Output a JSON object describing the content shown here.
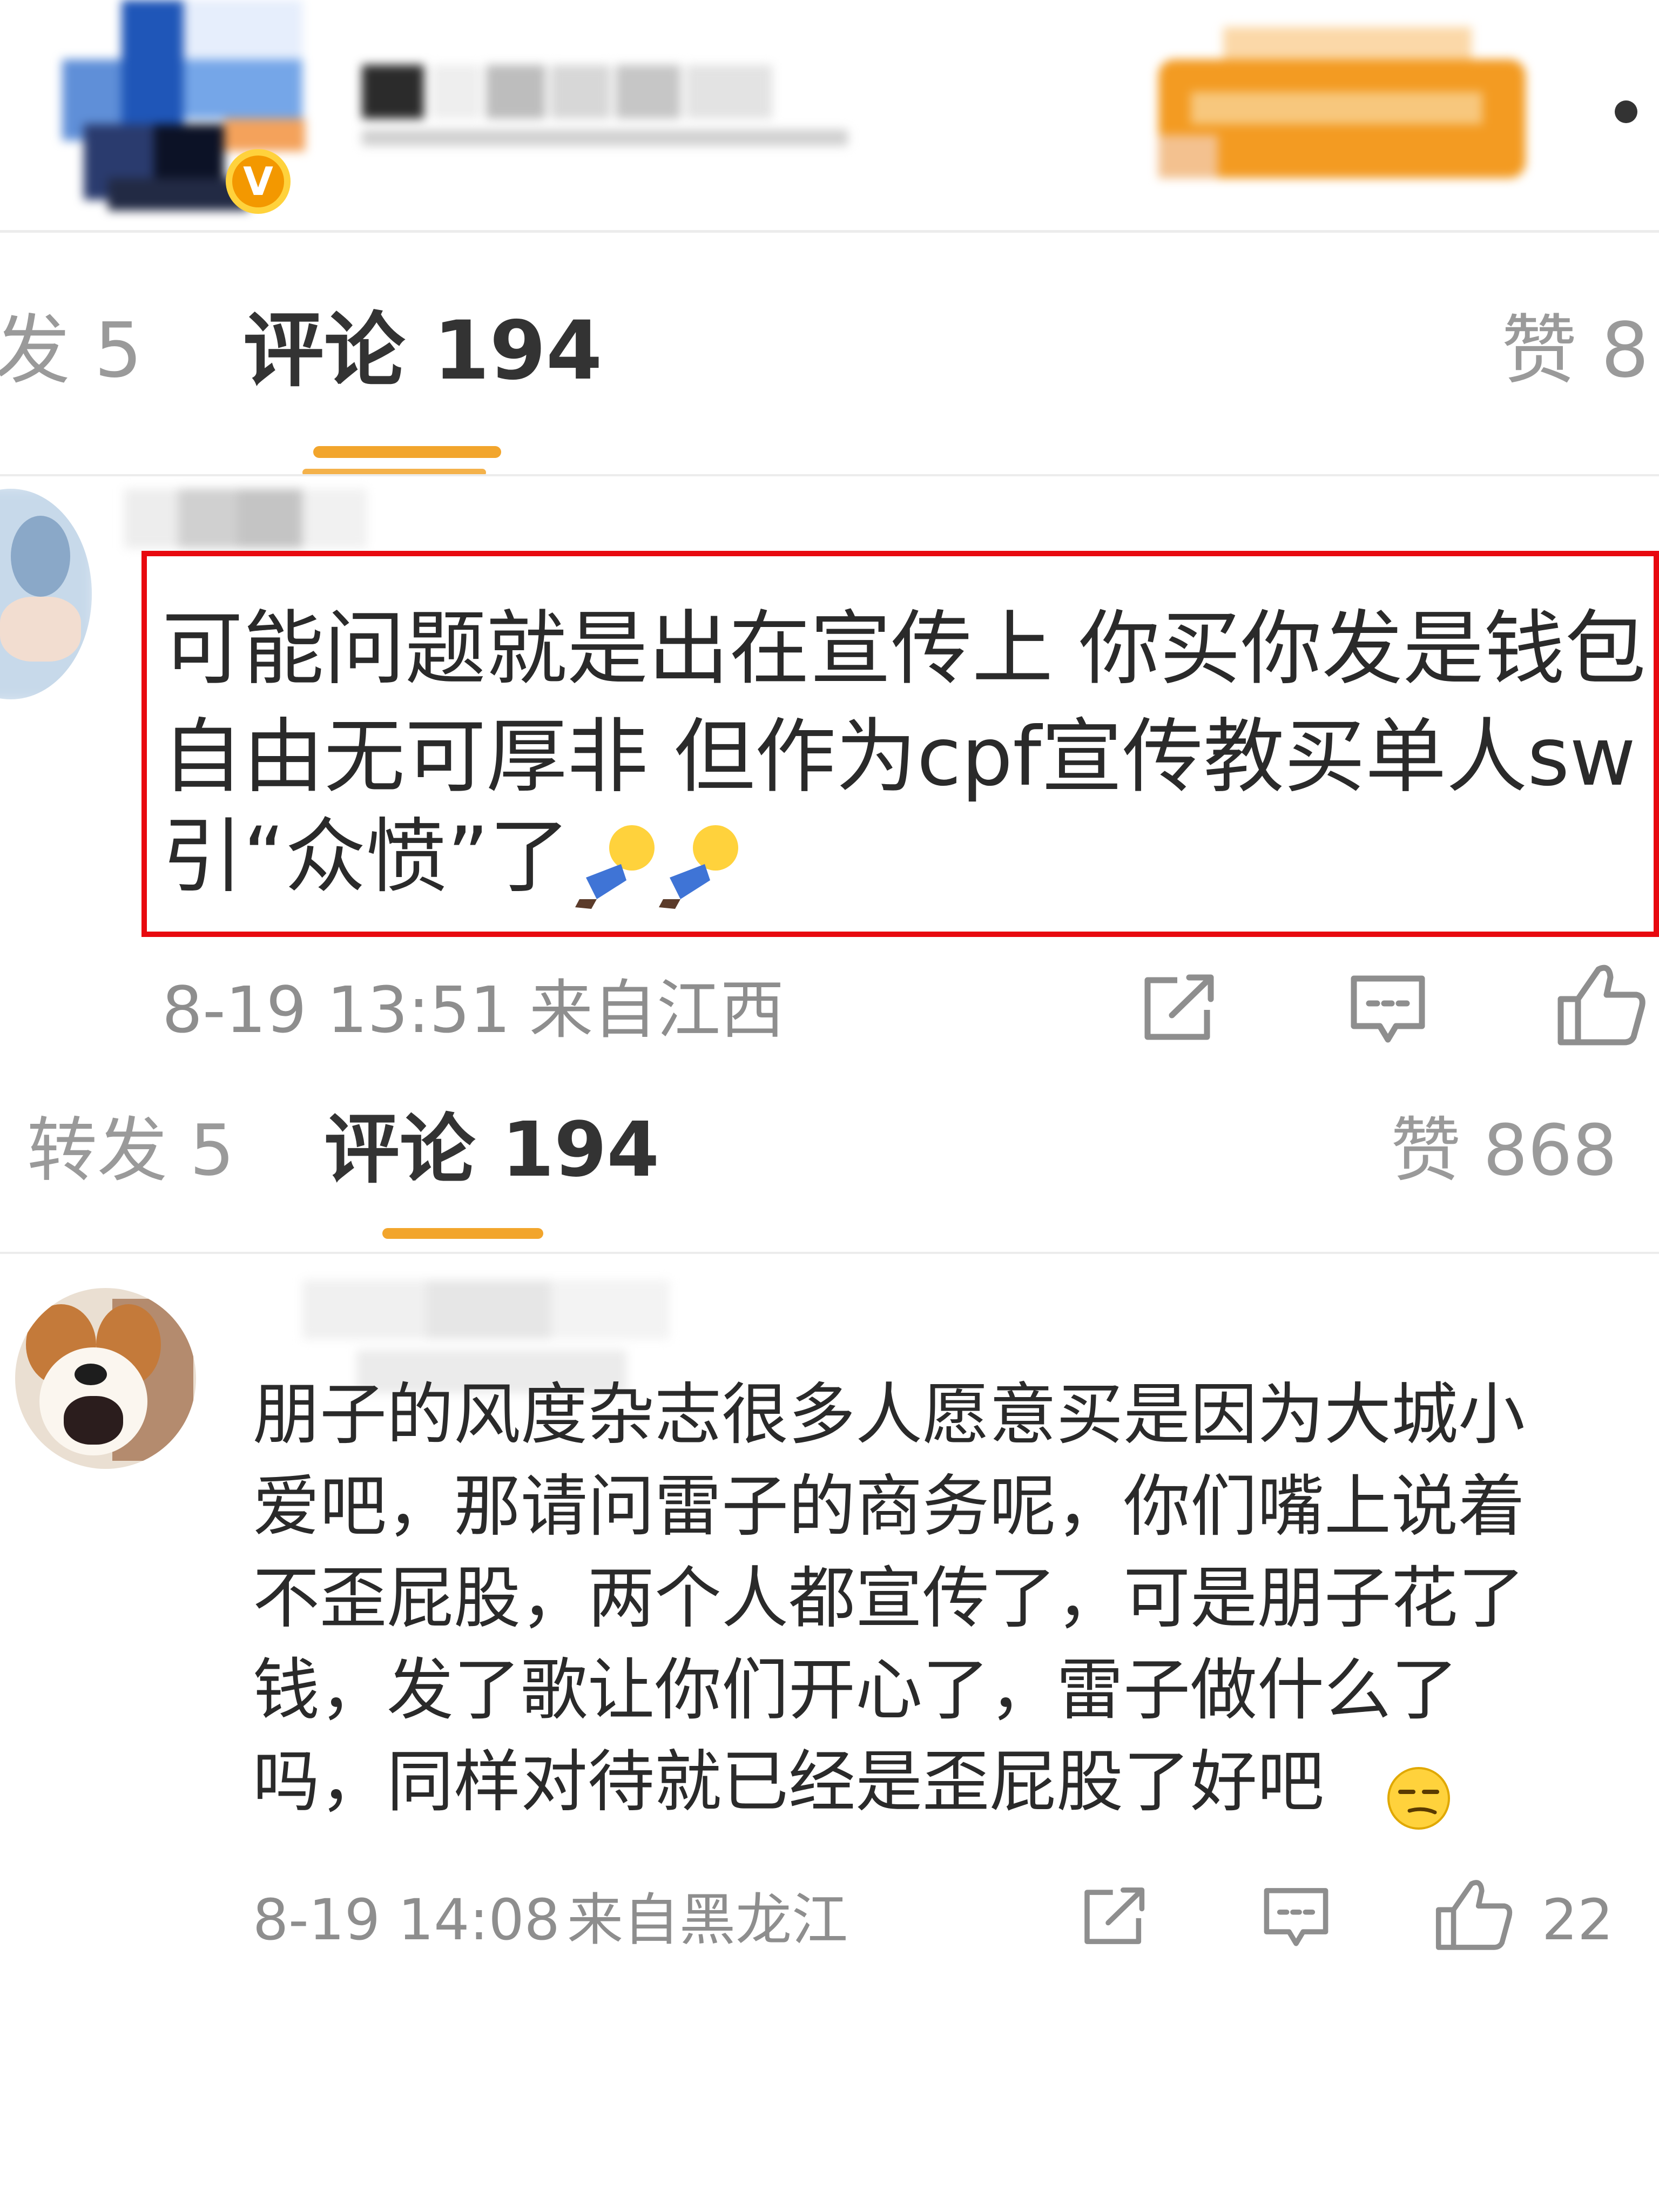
{
  "screenshot1": {
    "tabs": {
      "repost": "发 5",
      "comments": "评论 194",
      "likes": "赞 8"
    },
    "comment": {
      "lines": [
        "可能问题就是出在宣传上 你买你发是钱包",
        "自由无可厚非 但作为cpf宣传教买单人sw",
        "引“众愤”了"
      ],
      "emoji": "facedown-person-emoji",
      "time": "8-19 13:51",
      "location": "来自江西",
      "icons": [
        "share-icon",
        "comment-icon",
        "like-icon"
      ]
    }
  },
  "screenshot2": {
    "tabs": {
      "repost": "转发 5",
      "comments": "评论 194",
      "likes": "赞 868"
    },
    "comment": {
      "lines": [
        "朋子的风度杂志很多人愿意买是因为大城小",
        "爱吧，那请问雷子的商务呢，你们嘴上说着",
        "不歪屁股，两个人都宣传了，可是朋子花了",
        "钱，发了歌让你们开心了，雷子做什么了",
        "吗，同样对待就已经是歪屁股了好吧"
      ],
      "emoji": "smirk-emoji",
      "time": "8-19 14:08",
      "location": "来自黑龙江",
      "like_count": "22",
      "icons": [
        "share-icon",
        "comment-icon",
        "like-icon"
      ]
    }
  },
  "colors": {
    "accent_orange": "#f2a52c",
    "highlight_red": "#e8090f",
    "verified_orange": "#f39800",
    "muted_text": "#8e8e8e"
  }
}
